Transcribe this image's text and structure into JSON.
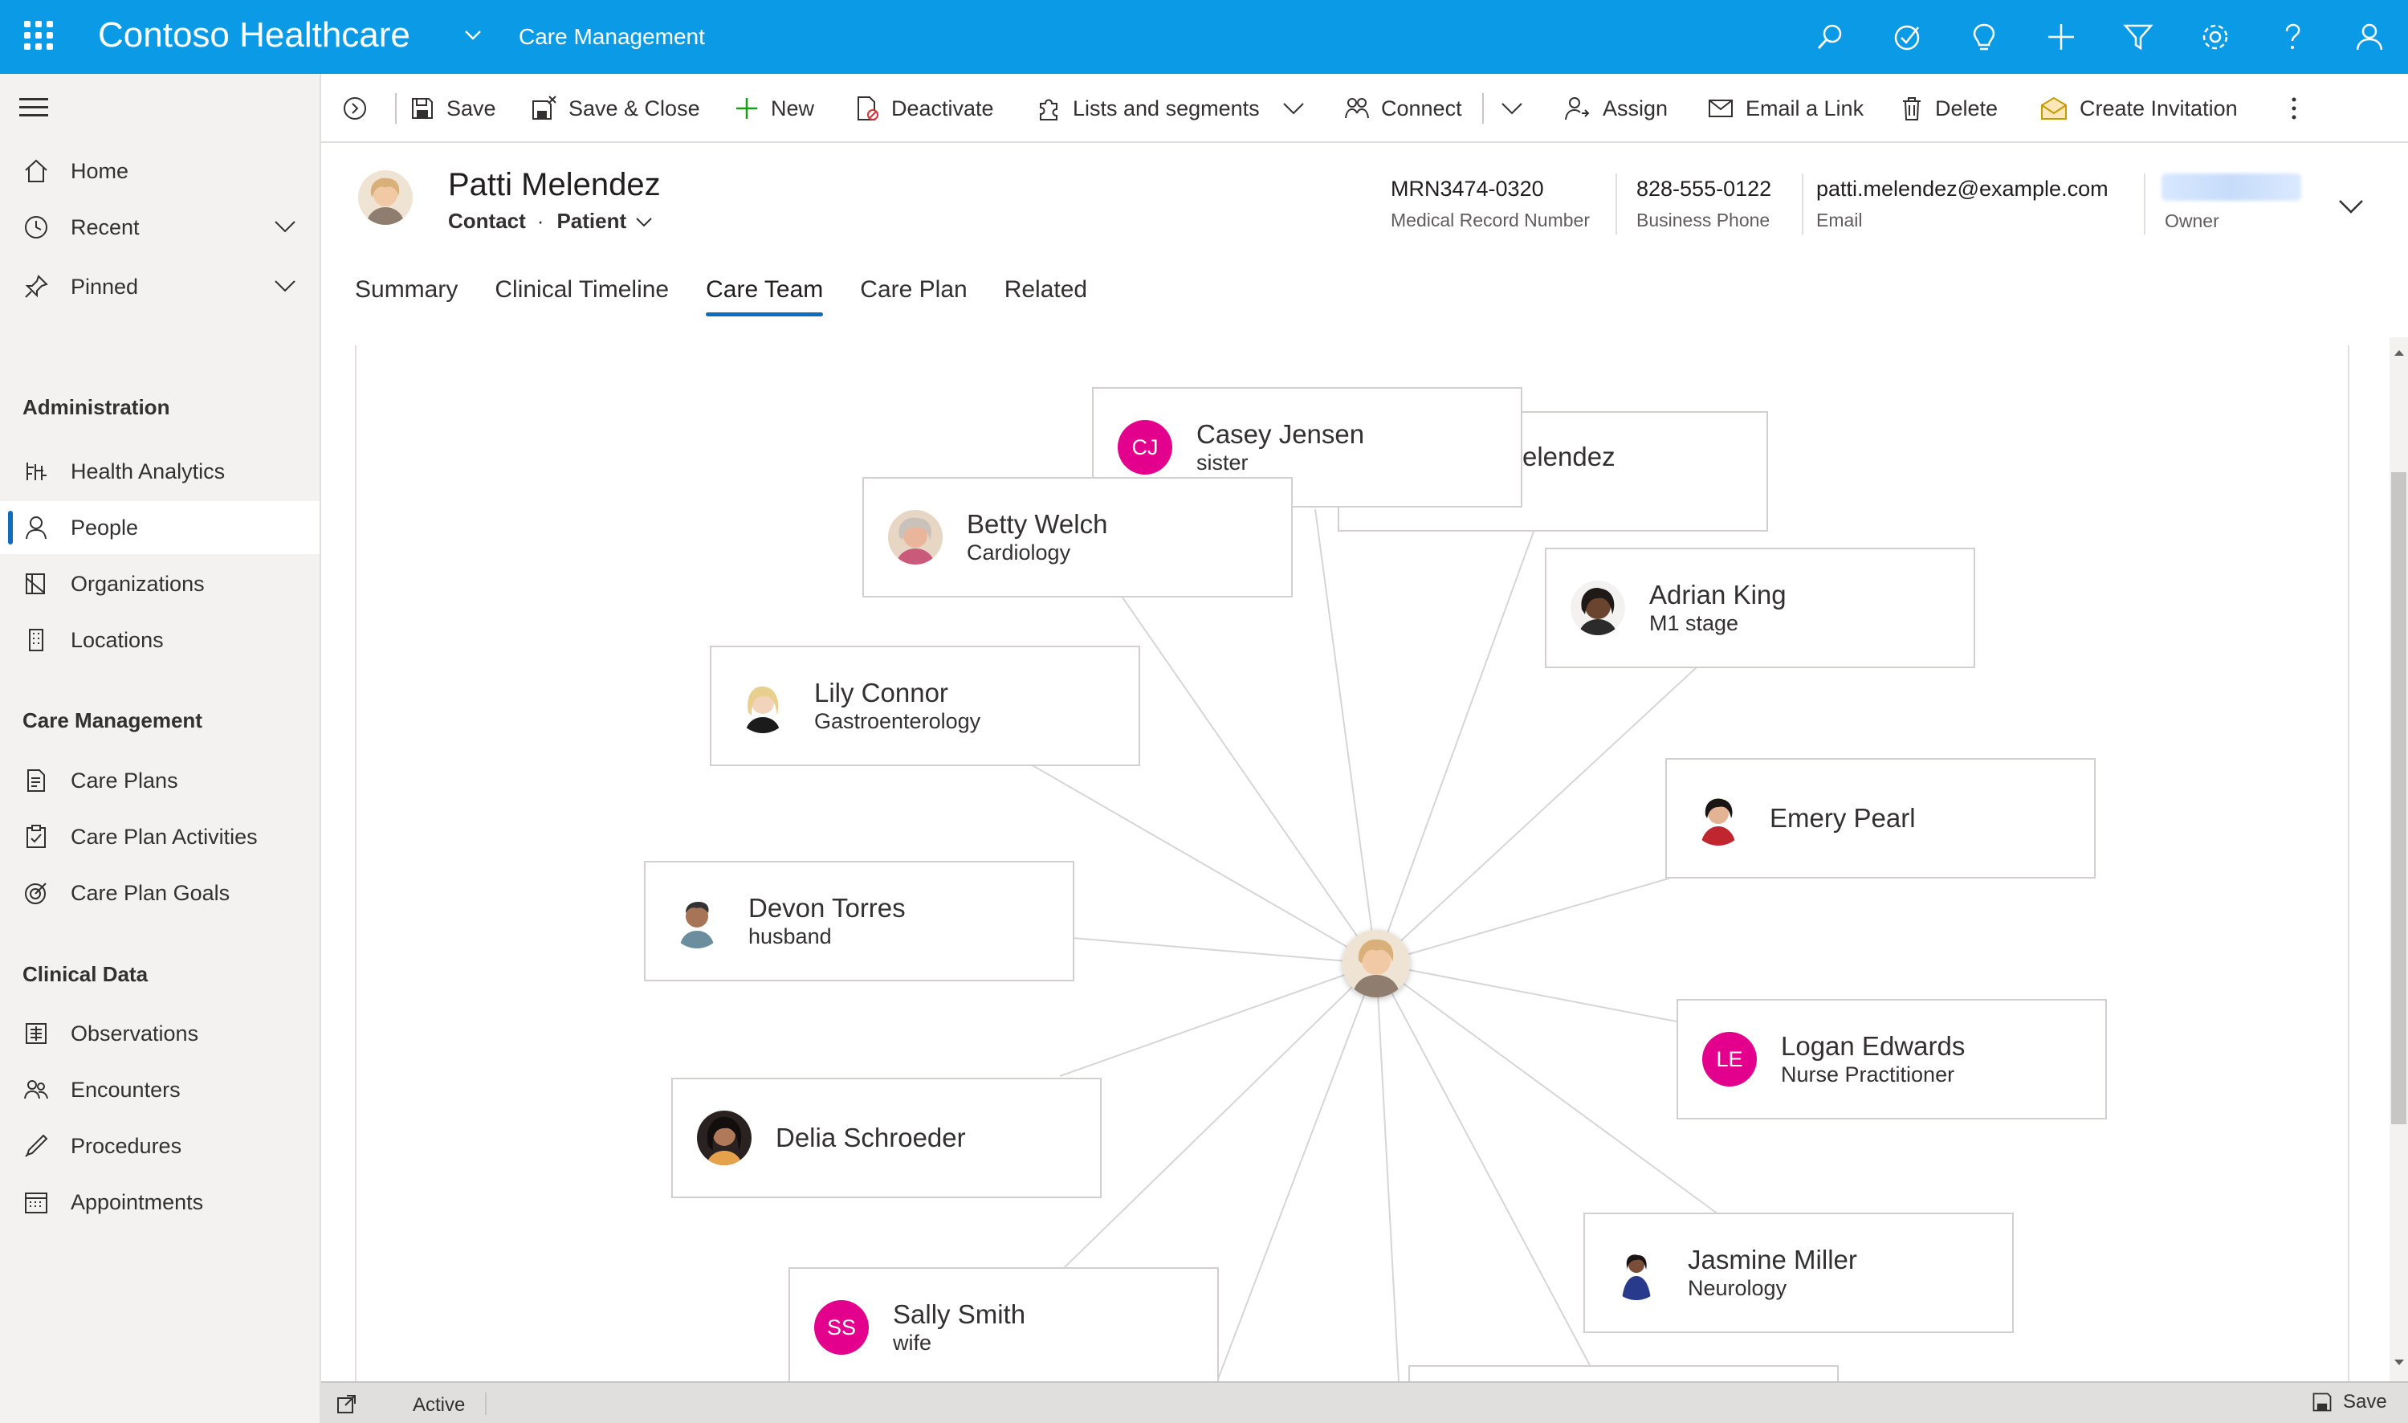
{
  "header": {
    "app_title": "Contoso Healthcare",
    "area": "Care Management",
    "icons": [
      "search-icon",
      "task-check-icon",
      "lightbulb-icon",
      "plus-icon",
      "filter-icon",
      "settings-icon",
      "help-icon",
      "user-icon"
    ]
  },
  "sidebar": {
    "items": [
      {
        "label": "Home",
        "icon": "home-icon"
      },
      {
        "label": "Recent",
        "icon": "clock-icon"
      },
      {
        "label": "Pinned",
        "icon": "pin-icon"
      }
    ],
    "sections": [
      {
        "title": "Administration",
        "items": [
          {
            "label": "Health Analytics",
            "icon": "analytics-icon"
          },
          {
            "label": "People",
            "icon": "person-icon",
            "selected": true
          },
          {
            "label": "Organizations",
            "icon": "organization-icon"
          },
          {
            "label": "Locations",
            "icon": "building-icon"
          }
        ]
      },
      {
        "title": "Care Management",
        "items": [
          {
            "label": "Care Plans",
            "icon": "care-plan-icon"
          },
          {
            "label": "Care Plan Activities",
            "icon": "activity-icon"
          },
          {
            "label": "Care Plan Goals",
            "icon": "goal-icon"
          }
        ]
      },
      {
        "title": "Clinical Data",
        "items": [
          {
            "label": "Observations",
            "icon": "observation-icon"
          },
          {
            "label": "Encounters",
            "icon": "encounter-icon"
          },
          {
            "label": "Procedures",
            "icon": "procedure-icon"
          },
          {
            "label": "Appointments",
            "icon": "calendar-icon"
          }
        ]
      }
    ]
  },
  "toolbar": {
    "save": "Save",
    "save_close": "Save & Close",
    "new": "New",
    "deactivate": "Deactivate",
    "lists_segments": "Lists and segments",
    "connect": "Connect",
    "assign": "Assign",
    "email_link": "Email a Link",
    "delete": "Delete",
    "create_invitation": "Create Invitation"
  },
  "record": {
    "name": "Patti Melendez",
    "entity": "Contact",
    "form": "Patient",
    "fields": [
      {
        "value": "MRN3474-0320",
        "label": "Medical Record Number"
      },
      {
        "value": "828-555-0122",
        "label": "Business Phone"
      },
      {
        "value": "patti.melendez@example.com",
        "label": "Email"
      },
      {
        "value": "",
        "label": "Owner"
      }
    ]
  },
  "tabs": [
    "Summary",
    "Clinical Timeline",
    "Care Team",
    "Care Plan",
    "Related"
  ],
  "active_tab": "Care Team",
  "care_team": {
    "center": "Patti Melendez",
    "members": [
      {
        "name": "Casey Jensen",
        "role": "sister",
        "initials": "CJ"
      },
      {
        "name": "elendez",
        "role": "",
        "initials": ""
      },
      {
        "name": "Betty Welch",
        "role": "Cardiology",
        "initials": ""
      },
      {
        "name": "Adrian King",
        "role": "M1 stage",
        "initials": ""
      },
      {
        "name": "Lily Connor",
        "role": "Gastroenterology",
        "initials": ""
      },
      {
        "name": "Emery Pearl",
        "role": "",
        "initials": ""
      },
      {
        "name": "Devon Torres",
        "role": "husband",
        "initials": ""
      },
      {
        "name": "Logan Edwards",
        "role": "Nurse Practitioner",
        "initials": "LE"
      },
      {
        "name": "Delia Schroeder",
        "role": "",
        "initials": ""
      },
      {
        "name": "Jasmine Miller",
        "role": "Neurology",
        "initials": ""
      },
      {
        "name": "Sally Smith",
        "role": "wife",
        "initials": "SS"
      }
    ]
  },
  "status": {
    "state": "Active",
    "save": "Save"
  },
  "colors": {
    "brand": "#0b9be6",
    "accent": "#0f6cbd",
    "initials_bg": "#e3008c"
  }
}
